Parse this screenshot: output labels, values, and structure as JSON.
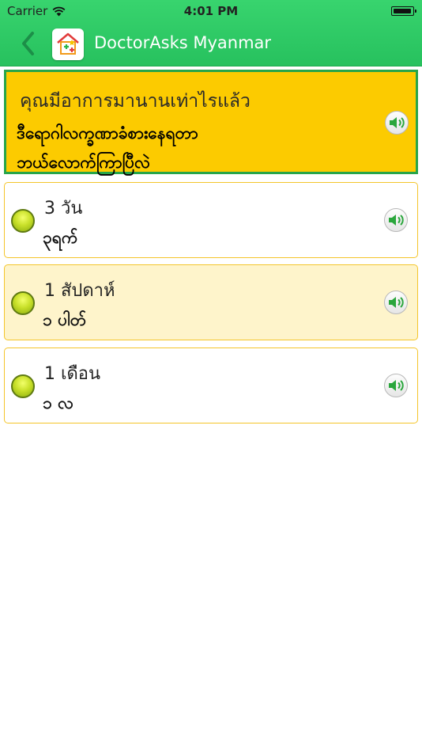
{
  "status_bar": {
    "carrier": "Carrier",
    "time": "4:01 PM"
  },
  "header": {
    "title": "DoctorAsks Myanmar",
    "back_icon": "chevron-left-icon",
    "logo_icon": "house-medical-logo-icon"
  },
  "question": {
    "thai": "คุณมีอาการมานานเท่าไรแล้ว",
    "myanmar_line1": "ဒီရောဂါလက္ခဏာခံစားနေရတာ",
    "myanmar_line2": "ဘယ်လောက်ကြာပြီလဲ",
    "speaker_icon": "speaker-icon"
  },
  "answers": [
    {
      "thai": "3 วัน",
      "myanmar": "၃ရက်",
      "speaker_icon": "speaker-icon"
    },
    {
      "thai": "1 สัปดาห์",
      "myanmar": "၁ ပါတ်",
      "speaker_icon": "speaker-icon"
    },
    {
      "thai": "1 เดือน",
      "myanmar": "၁ လ",
      "speaker_icon": "speaker-icon"
    }
  ],
  "colors": {
    "header_green": "#2cc864",
    "question_yellow": "#fccb00",
    "question_border": "#27a549",
    "card_border": "#f4c52a",
    "selected_card": "#fef4cb",
    "speaker_green": "#2aa63c"
  }
}
